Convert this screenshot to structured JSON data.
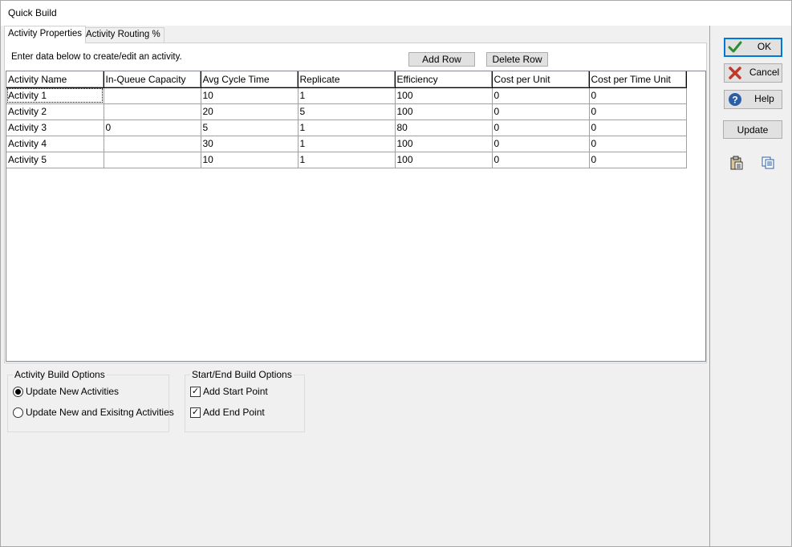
{
  "window": {
    "title": "Quick Build"
  },
  "tabs": [
    {
      "label": "Activity Properties",
      "active": true
    },
    {
      "label": "Activity Routing %",
      "active": false
    }
  ],
  "activity_tab": {
    "hint": "Enter data below to create/edit an activity.",
    "add_row_label": "Add Row",
    "delete_row_label": "Delete Row"
  },
  "grid": {
    "columns": [
      "Activity Name",
      "In-Queue Capacity",
      "Avg Cycle Time",
      "Replicate",
      "Efficiency",
      "Cost per Unit",
      "Cost per Time Unit"
    ],
    "rows": [
      [
        "Activity 1",
        "",
        "10",
        "1",
        "100",
        "0",
        "0"
      ],
      [
        "Activity 2",
        "",
        "20",
        "5",
        "100",
        "0",
        "0"
      ],
      [
        "Activity 3",
        "0",
        "5",
        "1",
        "80",
        "0",
        "0"
      ],
      [
        "Activity 4",
        "",
        "30",
        "1",
        "100",
        "0",
        "0"
      ],
      [
        "Activity 5",
        "",
        "10",
        "1",
        "100",
        "0",
        "0"
      ]
    ]
  },
  "activity_build_options": {
    "legend": "Activity Build Options",
    "options": [
      {
        "label": "Update New Activities",
        "selected": true
      },
      {
        "label": "Update New and Exisitng Activities",
        "selected": false
      }
    ]
  },
  "start_end_options": {
    "legend": "Start/End Build Options",
    "options": [
      {
        "label": "Add Start Point",
        "checked": true
      },
      {
        "label": "Add End Point",
        "checked": true
      }
    ]
  },
  "side_buttons": {
    "ok": "OK",
    "cancel": "Cancel",
    "help": "Help",
    "update": "Update"
  },
  "icons": {
    "ok": "checkmark-icon",
    "cancel": "x-icon",
    "help": "help-icon",
    "paste": "paste-icon",
    "copy": "copy-icon"
  },
  "colors": {
    "ok_check": "#2e8b2e",
    "cancel_x": "#c0392b",
    "help_circle": "#2b5ea7",
    "focus_border": "#0078d7"
  }
}
